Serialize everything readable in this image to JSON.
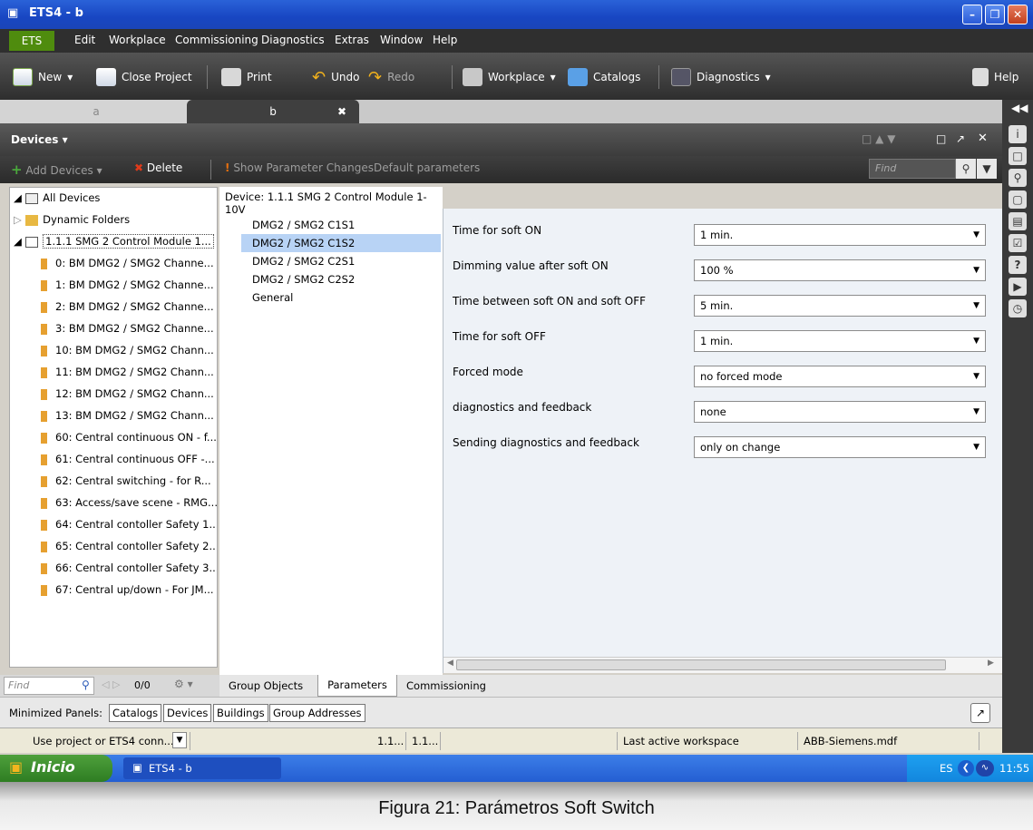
{
  "window": {
    "title": "ETS4 - b"
  },
  "menu": {
    "ets": "ETS",
    "items": [
      "Edit",
      "Workplace",
      "Commissioning",
      "Diagnostics",
      "Extras",
      "Window",
      "Help"
    ]
  },
  "toolbar": {
    "new": "New",
    "close_project": "Close Project",
    "print": "Print",
    "undo": "Undo",
    "redo": "Redo",
    "workplace": "Workplace",
    "catalogs": "Catalogs",
    "diagnostics": "Diagnostics",
    "help": "Help"
  },
  "tabs": [
    "a",
    "b"
  ],
  "devices_panel": {
    "title": "Devices",
    "add_devices": "Add Devices",
    "delete": "Delete",
    "show_param_changes": "Show Parameter Changes",
    "default_params": "Default parameters",
    "find_placeholder": "Find"
  },
  "tree": {
    "all_devices": "All Devices",
    "dynamic_folders": "Dynamic Folders",
    "device": "1.1.1  SMG 2 Control Module 1...",
    "objects": [
      "0: BM  DMG2 / SMG2 Channe...",
      "1: BM  DMG2 / SMG2 Channe...",
      "2: BM  DMG2 / SMG2 Channe...",
      "3: BM  DMG2 / SMG2 Channe...",
      "10: BM  DMG2 / SMG2 Chann...",
      "11: BM  DMG2 / SMG2 Chann...",
      "12: BM  DMG2 / SMG2 Chann...",
      "13: BM  DMG2 / SMG2 Chann...",
      "60: Central continuous ON - f...",
      "61: Central continuous OFF -...",
      "62: Central switching - for R...",
      "63: Access/save scene - RMG...",
      "64: Central contoller Safety 1...",
      "65: Central contoller Safety 2...",
      "66: Central contoller Safety 3...",
      "67: Central up/down - For JM..."
    ]
  },
  "device_header": "Device: 1.1.1  SMG 2 Control Module 1-10V",
  "param_groups": [
    "DMG2 / SMG2 C1S1",
    "DMG2 / SMG2 C1S2",
    "DMG2 / SMG2 C2S1",
    "DMG2 / SMG2 C2S2",
    "General"
  ],
  "selected_group": "DMG2 / SMG2 C1S2",
  "params": [
    {
      "label": "Time for soft ON",
      "value": "1 min."
    },
    {
      "label": "Dimming value after soft ON",
      "value": "100 %"
    },
    {
      "label": "Time between soft ON and soft OFF",
      "value": "5 min."
    },
    {
      "label": "Time for soft OFF",
      "value": "1 min."
    },
    {
      "label": "Forced mode",
      "value": "no forced mode"
    },
    {
      "label": "diagnostics and feedback",
      "value": "none"
    },
    {
      "label": "Sending diagnostics and feedback",
      "value": "only on change"
    }
  ],
  "find_bar": {
    "placeholder": "Find",
    "count": "0/0"
  },
  "bottom_tabs": [
    "Group Objects",
    "Parameters",
    "Commissioning"
  ],
  "minimized": {
    "label": "Minimized Panels:",
    "buttons": [
      "Catalogs",
      "Devices",
      "Buildings",
      "Group Addresses"
    ]
  },
  "status": {
    "connection": "Use project or ETS4 conn...",
    "addr1": "1.1...",
    "addr2": "1.1...",
    "workspace": "Last active workspace",
    "db": "ABB-Siemens.mdf"
  },
  "taskbar": {
    "start": "Inicio",
    "task": "ETS4 - b",
    "lang": "ES",
    "time": "11:55"
  },
  "caption": "Figura 21: Parámetros Soft Switch",
  "colors": {
    "accent_green": "#4f8c0e",
    "selection": "#b8d3f5"
  }
}
